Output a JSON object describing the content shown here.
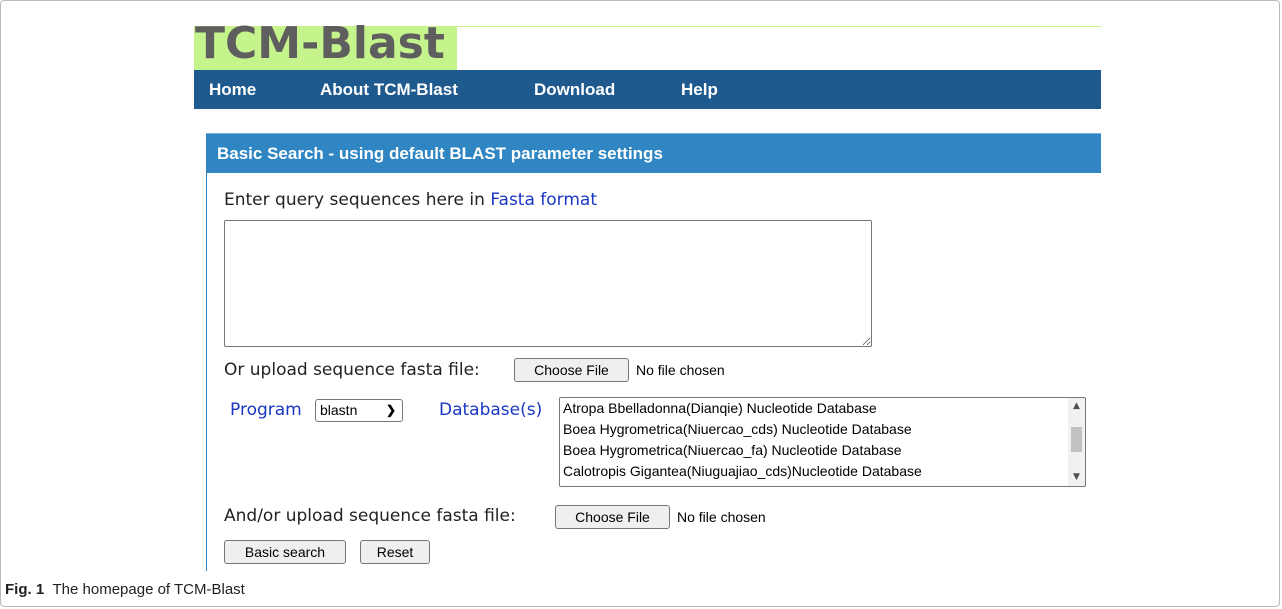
{
  "site": {
    "logo": "TCM-Blast",
    "nav": [
      "Home",
      "About TCM-Blast",
      "Download",
      "Help"
    ]
  },
  "panel": {
    "title": "Basic Search - using default BLAST parameter settings",
    "query_prompt": "Enter query sequences here in ",
    "query_link": "Fasta format",
    "query_value": "",
    "upload_label": "Or upload sequence fasta file:",
    "choose_file_label": "Choose File",
    "no_file_text": "No file chosen",
    "program_label": "Program",
    "program_selected": "blastn",
    "database_label": "Database(s)",
    "databases": [
      "Atropa Bbelladonna(Dianqie) Nucleotide Database",
      "Boea Hygrometrica(Niuercao_cds) Nucleotide Database",
      "Boea Hygrometrica(Niuercao_fa) Nucleotide Database",
      "Calotropis Gigantea(Niuguajiao_cds)Nucleotide Database"
    ],
    "upload2_label": "And/or upload sequence fasta file:",
    "choose_file2_label": "Choose File",
    "no_file2_text": "No file chosen",
    "basic_search_label": "Basic search",
    "reset_label": "Reset"
  },
  "caption": {
    "fig": "Fig. 1",
    "text": "The homepage of TCM-Blast"
  },
  "colors": {
    "logo_bg": "#c6f48c",
    "nav_bg": "#1e5a8e",
    "panel_header_bg": "#2f86c3",
    "link": "#1a37c4"
  }
}
